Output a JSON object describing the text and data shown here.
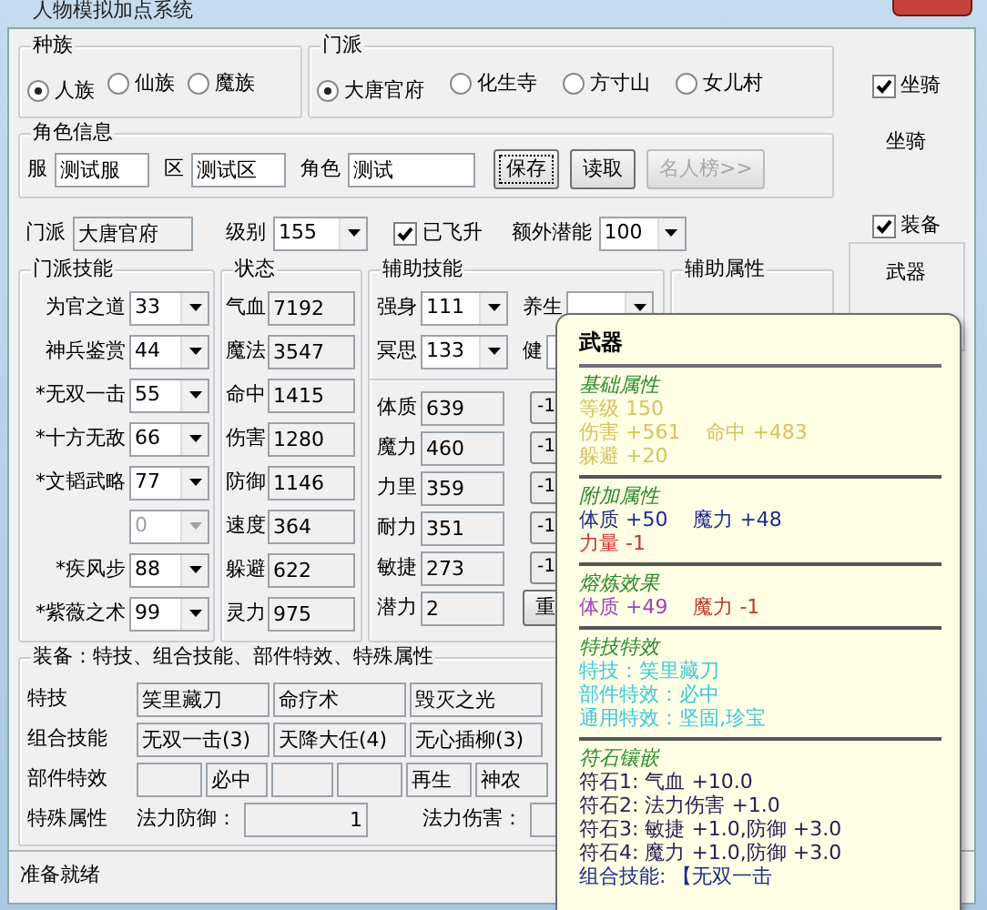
{
  "window": {
    "title": "人物模拟加点系统"
  },
  "race": {
    "label": "种族",
    "options": [
      {
        "label": "人族",
        "selected": true
      },
      {
        "label": "仙族",
        "selected": false
      },
      {
        "label": "魔族",
        "selected": false
      }
    ]
  },
  "school": {
    "label": "门派",
    "options": [
      {
        "label": "大唐官府",
        "selected": true
      },
      {
        "label": "化生寺",
        "selected": false
      },
      {
        "label": "方寸山",
        "selected": false
      },
      {
        "label": "女儿村",
        "selected": false
      }
    ]
  },
  "mount": {
    "label": "坐骑",
    "checked": true,
    "caption": "坐骑"
  },
  "role_info": {
    "label": "角色信息",
    "fields": [
      {
        "label": "服",
        "value": "测试服"
      },
      {
        "label": "区",
        "value": "测试区"
      },
      {
        "label": "角色",
        "value": "测试"
      }
    ],
    "buttons": [
      {
        "label": "保存",
        "focused": true,
        "disabled": false
      },
      {
        "label": "读取",
        "focused": false,
        "disabled": false
      },
      {
        "label": "名人榜>>",
        "focused": false,
        "disabled": true
      }
    ]
  },
  "profile": {
    "school_label": "门派",
    "school_value": "大唐官府",
    "level_label": "级别",
    "level": "155",
    "ascended": {
      "label": "已飞升",
      "checked": true
    },
    "extra_label": "额外潜能",
    "extra": "100"
  },
  "equipment_toggle": {
    "label": "装备",
    "checked": true,
    "items": [
      "武器"
    ]
  },
  "school_skills": {
    "label": "门派技能",
    "rows": [
      {
        "label": "为官之道",
        "value": "33",
        "disabled": false
      },
      {
        "label": "神兵鉴赏",
        "value": "44",
        "disabled": false
      },
      {
        "label": "*无双一击",
        "value": "55",
        "disabled": false
      },
      {
        "label": "*十方无敌",
        "value": "66",
        "disabled": false
      },
      {
        "label": "*文韬武略",
        "value": "77",
        "disabled": false
      },
      {
        "value": "0",
        "disabled": true
      },
      {
        "label": "*疾风步",
        "value": "88",
        "disabled": false
      },
      {
        "label": "*紫薇之术",
        "value": "99",
        "disabled": false
      }
    ]
  },
  "status": {
    "label": "状态",
    "rows": [
      {
        "label": "气血",
        "value": "7192"
      },
      {
        "label": "魔法",
        "value": "3547"
      },
      {
        "label": "命中",
        "value": "1415"
      },
      {
        "label": "伤害",
        "value": "1280"
      },
      {
        "label": "防御",
        "value": "1146"
      },
      {
        "label": "速度",
        "value": "364"
      },
      {
        "label": "躲避",
        "value": "622"
      },
      {
        "label": "灵力",
        "value": "975"
      }
    ]
  },
  "aux_skills": {
    "label": "辅助技能",
    "items": [
      {
        "label": "强身",
        "value": "111"
      },
      {
        "label": "养生"
      },
      {
        "label": "冥思",
        "value": "133"
      },
      {
        "label": "健"
      }
    ]
  },
  "attributes": {
    "rows": [
      {
        "label": "体质",
        "value": "639",
        "button": "-1"
      },
      {
        "label": "魔力",
        "value": "460",
        "button": "-1"
      },
      {
        "label": "力里",
        "value": "359",
        "button": "-1"
      },
      {
        "label": "耐力",
        "value": "351",
        "button": "-1"
      },
      {
        "label": "敏捷",
        "value": "273",
        "button": "-1"
      }
    ],
    "potential": {
      "label": "潜力",
      "value": "2"
    },
    "reset_button": "重"
  },
  "aux_attributes": {
    "label": "辅助属性"
  },
  "equipment": {
    "label": "装备：特技、组合技能、部件特效、特殊属性",
    "rows": [
      {
        "label": "特技",
        "cells": [
          {
            "value": "笑里藏刀"
          },
          {
            "value": "命疗术"
          },
          {
            "value": "毁灭之光"
          }
        ]
      },
      {
        "label": "组合技能",
        "cells": [
          {
            "value": "无双一击(3)"
          },
          {
            "value": "天降大任(4)"
          },
          {
            "value": "无心插柳(3)"
          }
        ]
      },
      {
        "label": "部件特效",
        "cells": [
          {},
          {
            "value": "必中"
          },
          {},
          {},
          {
            "value": "再生"
          },
          {
            "value": "神农"
          }
        ]
      }
    ],
    "special": {
      "label": "特殊属性",
      "fields": [
        {
          "label": "法力防御：",
          "value": "1"
        },
        {
          "label": "法力伤害："
        }
      ]
    }
  },
  "status_bar": "准备就绪",
  "tooltip": {
    "title": "武器",
    "sections": [
      {
        "heading": "基础属性",
        "lines": [
          [
            {
              "text": "等级  150",
              "color": "#d6c25e"
            }
          ],
          [
            {
              "text": "伤害 +561",
              "color": "#d6c25e"
            },
            {
              "text": "命中 +483",
              "color": "#d6c25e"
            }
          ],
          [
            {
              "text": "躲避 +20",
              "color": "#d6c25e"
            }
          ]
        ]
      },
      {
        "heading": "附加属性",
        "lines": [
          [
            {
              "text": "体质 +50",
              "color": "#1e2a8a"
            },
            {
              "text": "魔力 +48",
              "color": "#1e2a8a"
            }
          ],
          [
            {
              "text": "力量 -1",
              "color": "#d0302a"
            }
          ]
        ]
      },
      {
        "heading": "熔炼效果",
        "lines": [
          [
            {
              "text": "体质 +49",
              "color": "#a040c0"
            },
            {
              "text": "魔力 -1",
              "color": "#b83a2a"
            }
          ]
        ]
      },
      {
        "heading": "特技特效",
        "lines": [
          [
            {
              "text": "特技：笑里藏刀",
              "color": "#3cc8dc"
            }
          ],
          [
            {
              "text": "部件特效：必中",
              "color": "#3cc8dc"
            }
          ],
          [
            {
              "text": "通用特效：坚固,珍宝",
              "color": "#3cc8dc"
            }
          ]
        ]
      },
      {
        "heading": "符石镶嵌",
        "lines": [
          [
            {
              "text": "符石1: 气血 +10.0",
              "color": "#2a2050"
            }
          ],
          [
            {
              "text": "符石2: 法力伤害 +1.0",
              "color": "#2a2050"
            }
          ],
          [
            {
              "text": "符石3: 敏捷 +1.0,防御 +3.0",
              "color": "#2a2050"
            }
          ],
          [
            {
              "text": "符石4: 魔力 +1.0,防御 +3.0",
              "color": "#2a2050"
            }
          ],
          [
            {
              "text": "组合技能: 【无双一击",
              "color": "#1e2a8a"
            }
          ]
        ]
      }
    ]
  }
}
